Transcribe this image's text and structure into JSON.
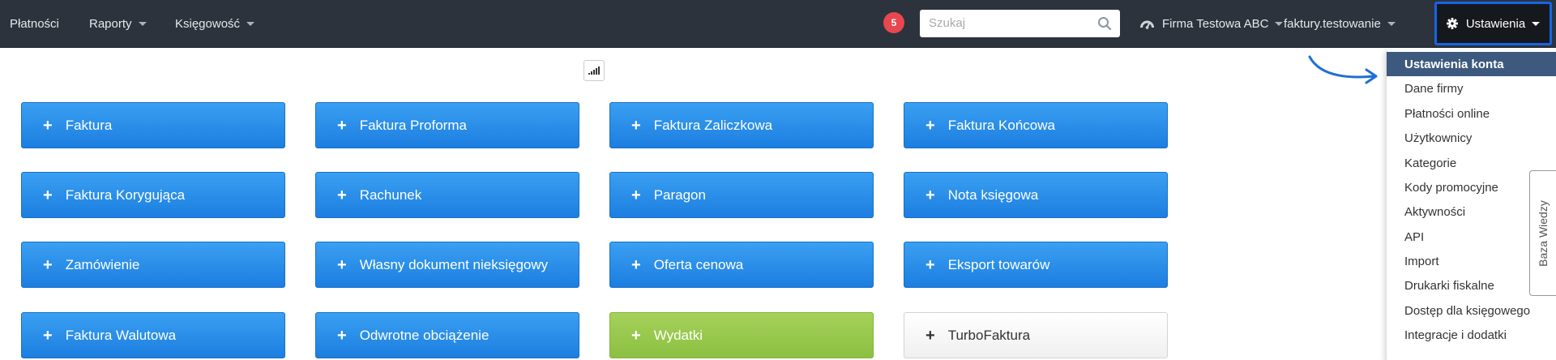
{
  "nav": {
    "platnosci": "Płatności",
    "raporty": "Raporty",
    "ksiegowosc": "Księgowość",
    "notification_count": "5",
    "search_placeholder": "Szukaj",
    "company": "Firma Testowa ABC",
    "user": "faktury.testowanie",
    "settings": "Ustawienia"
  },
  "buttons": {
    "plus": "+",
    "faktura": "Faktura",
    "faktura_proforma": "Faktura Proforma",
    "faktura_zaliczkowa": "Faktura Zaliczkowa",
    "faktura_koncowa": "Faktura Końcowa",
    "faktura_korygujaca": "Faktura Korygująca",
    "rachunek": "Rachunek",
    "paragon": "Paragon",
    "nota_ksiegowa": "Nota księgowa",
    "zamowienie": "Zamówienie",
    "wlasny_dokument": "Własny dokument nieksięgowy",
    "oferta_cenowa": "Oferta cenowa",
    "eksport_towarow": "Eksport towarów",
    "faktura_walutowa": "Faktura Walutowa",
    "odwrotne_obciazenie": "Odwrotne obciążenie",
    "wydatki": "Wydatki",
    "turbofaktura": "TurboFaktura"
  },
  "dropdown": {
    "items": [
      "Ustawienia konta",
      "Dane firmy",
      "Płatności online",
      "Użytkownicy",
      "Kategorie",
      "Kody promocyjne",
      "Aktywności",
      "API",
      "Import",
      "Drukarki fiskalne",
      "Dostęp dla księgowego",
      "Integracje i dodatki"
    ],
    "active_index": 0
  },
  "side_tab": "Baza Wiedzy",
  "colors": {
    "navbar": "#2c333c",
    "primary_button": "#2b8deb",
    "success_button": "#97c84d",
    "highlight_border": "#1565e6",
    "badge": "#e8474f",
    "dropdown_active": "#3d5a7e"
  },
  "icons": {
    "company": "dashboard-gauge-icon",
    "settings": "gear-icon",
    "search": "search-icon",
    "stats": "signal-bars-icon",
    "annotation": "curved-arrow-icon"
  }
}
